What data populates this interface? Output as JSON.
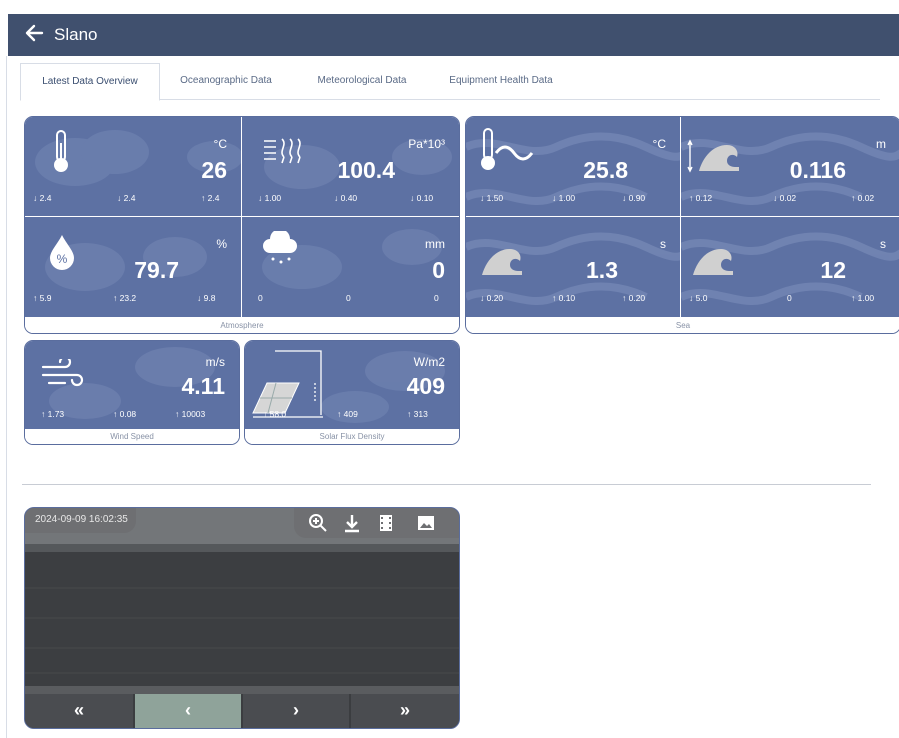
{
  "header": {
    "back_icon": "arrow-left-icon",
    "title": "Slano",
    "color": "#40506e"
  },
  "tabs": [
    {
      "label": "Latest Data Overview",
      "active": true
    },
    {
      "label": "Oceanographic Data",
      "active": false
    },
    {
      "label": "Meteorological Data",
      "active": false
    },
    {
      "label": "Equipment Health Data",
      "active": false
    }
  ],
  "atmosphere": {
    "label": "Atmosphere",
    "cards": [
      {
        "icon": "thermometer-icon",
        "unit": "°C",
        "value": "26",
        "stats": [
          "↓ 2.4",
          "↓ 2.4",
          "↑ 2.4"
        ]
      },
      {
        "icon": "pressure-icon",
        "unit": "Pa*10³",
        "value": "100.4",
        "stats": [
          "↓ 1.00",
          "↓ 0.40",
          "↓ 0.10"
        ]
      },
      {
        "icon": "humidity-drop-icon",
        "unit": "%",
        "value": "79.7",
        "stats": [
          "↑ 5.9",
          "↑ 23.2",
          "↓ 9.8"
        ]
      },
      {
        "icon": "rain-cloud-icon",
        "unit": "mm",
        "value": "0",
        "stats": [
          "0",
          "0",
          "0"
        ]
      }
    ]
  },
  "sea": {
    "label": "Sea",
    "cards": [
      {
        "icon": "water-temperature-icon",
        "unit": "°C",
        "value": "25.8",
        "stats": [
          "↓ 1.50",
          "↓ 1.00",
          "↓ 0.90"
        ]
      },
      {
        "icon": "wave-height-icon",
        "unit": "m",
        "value": "0.116",
        "stats": [
          "↑ 0.12",
          "↓ 0.02",
          "↑ 0.02"
        ]
      },
      {
        "icon": "wave-period-icon",
        "unit": "s",
        "value": "1.3",
        "stats": [
          "↓ 0.20",
          "↑ 0.10",
          "↑ 0.20"
        ]
      },
      {
        "icon": "wave-icon",
        "unit": "s",
        "value": "12",
        "stats": [
          "↓ 5.0",
          "0",
          "↑ 1.00"
        ]
      }
    ]
  },
  "wind": {
    "label": "Wind Speed",
    "icon": "wind-icon",
    "unit": "m/s",
    "value": "4.11",
    "stats": [
      "↑ 1.73",
      "↑ 0.08",
      "↑ 10003"
    ]
  },
  "solar": {
    "label": "Solar Flux Density",
    "icon": "solar-panel-icon",
    "unit": "W/m2",
    "value": "409",
    "stats": [
      "↑ 58.0",
      "↑ 409",
      "↑ 313"
    ]
  },
  "camera": {
    "timestamp": "2024-09-09 16:02:35",
    "tools": [
      "zoom-in-icon",
      "download-icon",
      "film-icon",
      "image-icon"
    ],
    "nav": [
      "«",
      "‹",
      "›",
      "»"
    ]
  },
  "colors": {
    "card": "#5d71a3",
    "border": "#5a6d9e"
  }
}
